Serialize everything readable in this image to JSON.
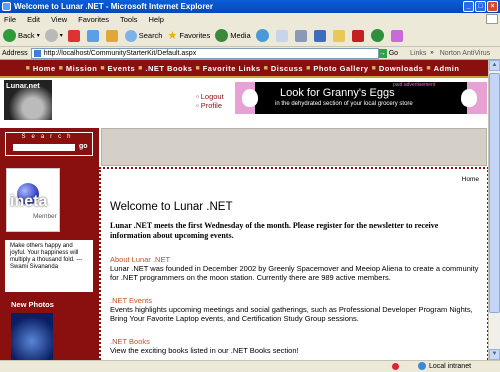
{
  "window": {
    "title": "Welcome to Lunar .NET - Microsoft Internet Explorer"
  },
  "menu": [
    "File",
    "Edit",
    "View",
    "Favorites",
    "Tools",
    "Help"
  ],
  "toolbar": {
    "back": "Back",
    "search": "Search",
    "favorites": "Favorites",
    "media": "Media"
  },
  "address": {
    "label": "Address",
    "url": "http://localhost/CommunityStarterKit/Default.aspx",
    "go": "Go",
    "links": "Links",
    "norton": "Norton AntiVirus"
  },
  "nav": [
    "Home",
    "Mission",
    "Events",
    ".NET Books",
    "Favorite Links",
    "Discuss",
    "Photo Gallery",
    "Downloads",
    "Admin"
  ],
  "header": {
    "logo": "Lunar.net",
    "links": [
      "Logout",
      "Profile"
    ],
    "ad": {
      "headline": "Look for Granny's Eggs",
      "subline": "in the dehydrated section of your local grocery store",
      "tag": "paid advertisement"
    }
  },
  "sidebar": {
    "search_label": "Search",
    "search_go": "go",
    "ineta": {
      "word": "ineta",
      "member": "Member"
    },
    "quote": "Make others happy and joyful. Your happiness will multiply a thousand fold. --- Swami Sivananda",
    "photos_title": "New Photos"
  },
  "content": {
    "home_link": "Home",
    "title": "Welcome to Lunar .NET",
    "lead": "Lunar .NET meets the first Wednesday of the month. Please register for the newsletter to receive information about upcoming events.",
    "sections": [
      {
        "title": "About Lunar .NET",
        "text": "Lunar .NET was founded in December 2002 by Greenly Spacemover and Meeiop Aliena to create a community for .NET programmers on the moon station. Currently there are 989 active members."
      },
      {
        "title": ".NET Events",
        "text": "Events highlights upcoming meetings and social gatherings, such as Professional Developer Program Nights, Bring Your Favorite Laptop events, and Certification Study Group sessions."
      },
      {
        "title": ".NET Books",
        "text": "View the exciting books listed in our .NET Books section!"
      }
    ]
  },
  "status": {
    "zone": "Local intranet"
  }
}
